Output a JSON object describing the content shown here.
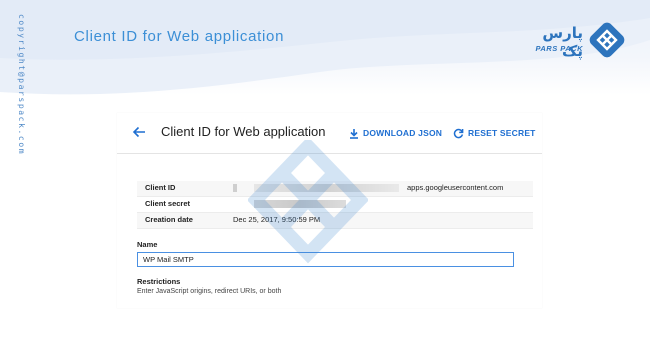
{
  "page": {
    "heading": "Client ID for Web application",
    "copyright_vertical": "copyright@parspack.com"
  },
  "logo": {
    "name_fa": "پارس پک",
    "name_en": "PARS PACK"
  },
  "card": {
    "title": "Client ID for Web application",
    "download_label": "DOWNLOAD JSON",
    "reset_label": "RESET SECRET",
    "info_rows": [
      {
        "label": "Client ID",
        "value_suffix": "apps.googleusercontent.com"
      },
      {
        "label": "Client secret",
        "value": ""
      },
      {
        "label": "Creation date",
        "value": "Dec 25, 2017, 9:50:59 PM"
      }
    ],
    "name_label": "Name",
    "name_value": "WP Mail SMTP",
    "restrictions_heading": "Restrictions",
    "restrictions_desc": "Enter JavaScript origins, redirect URIs, or both"
  },
  "colors": {
    "accent": "#1f6fd1",
    "brand": "#2d74bd",
    "heading": "#3c8fd6",
    "input_border": "#4a90e2"
  },
  "icons": {
    "back": "arrow-left-icon",
    "download": "download-icon",
    "reset": "refresh-icon",
    "logo": "diamond-logo-icon"
  }
}
